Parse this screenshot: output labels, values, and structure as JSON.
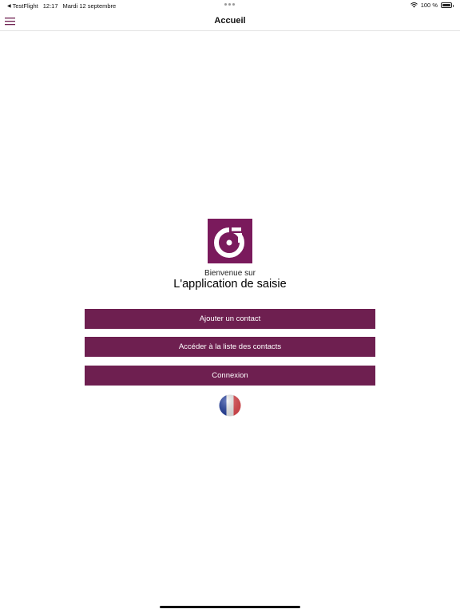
{
  "status_bar": {
    "back_app": "TestFlight",
    "time": "12:17",
    "date": "Mardi 12 septembre",
    "battery": "100 %",
    "icons": [
      "back-arrow-icon",
      "wifi-icon",
      "battery-icon"
    ]
  },
  "nav": {
    "title": "Accueil",
    "menu_icon": "hamburger-menu-icon",
    "accent_color": "#6e1f50"
  },
  "main": {
    "logo_icon": "app-logo-icon",
    "welcome": "Bienvenue sur",
    "app_name": "L'application de saisie",
    "buttons": {
      "add_contact": "Ajouter un contact",
      "contact_list": "Accéder à la liste des contacts",
      "login": "Connexion"
    },
    "language_icon": "french-flag-icon",
    "brand_color": "#6e1f50"
  }
}
